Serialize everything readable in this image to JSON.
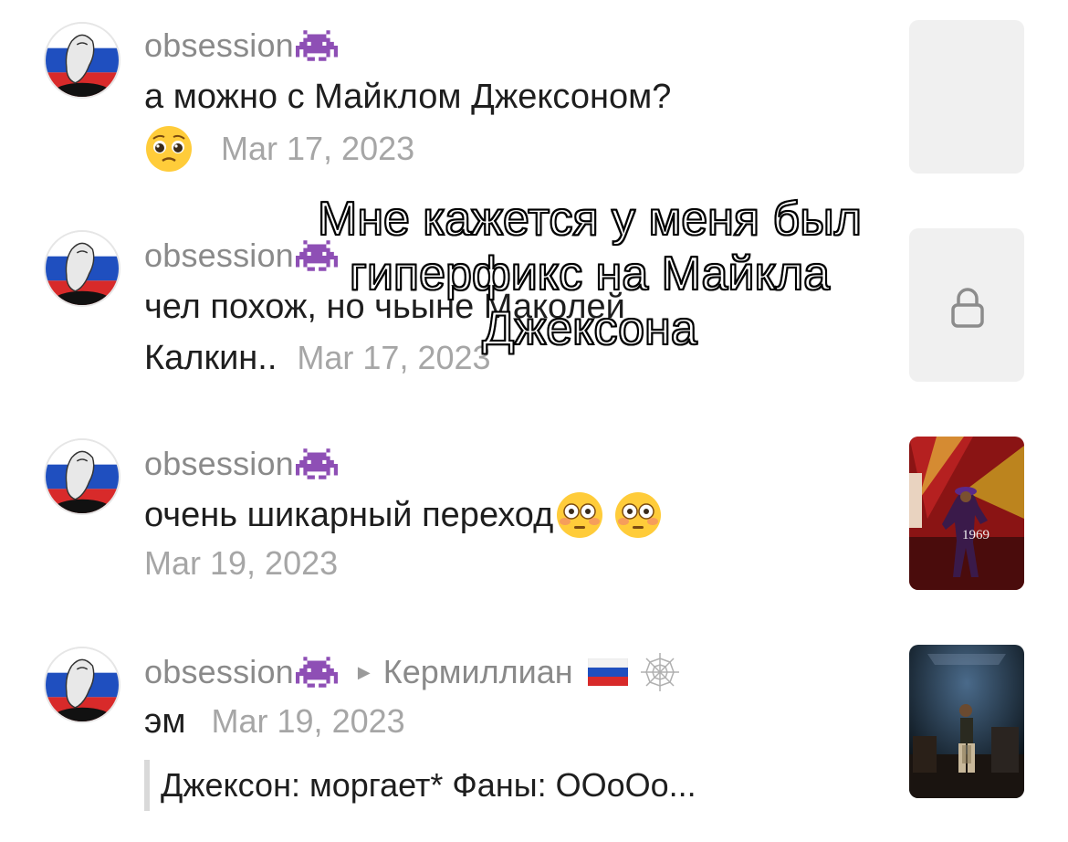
{
  "comments": [
    {
      "username": "obsession",
      "text": "а можно с Майклом Джексоном?",
      "date": "Mar 17, 2023",
      "thumb": "blank"
    },
    {
      "username": "obsession",
      "text_line1": "чел похож, но чьыне Маколей",
      "text_line2": "Калкин..",
      "date": "Mar 17, 2023",
      "thumb": "lock"
    },
    {
      "username": "obsession",
      "text": "очень шикарный переход",
      "date": "Mar 19, 2023",
      "thumb_caption": "1969"
    },
    {
      "username": "obsession",
      "reply_to": "Кермиллиан",
      "text": "эм",
      "date": "Mar 19, 2023",
      "quote": "Джексон: моргает* Фаны: ООоОо..."
    }
  ],
  "overlay": {
    "line1": "Мне кажется у меня был",
    "line2": "гиперфикс на Майкла",
    "line3": "Джексона"
  },
  "icons": {
    "username_badge": "space-invader-icon",
    "lock": "lock-icon",
    "reply": "reply-arrow-icon",
    "flag": "russia-flag-icon",
    "web": "spider-web-icon",
    "pleading": "pleading-face-icon",
    "flushed": "flushed-face-icon"
  },
  "colors": {
    "username": "#8a8a8a",
    "date": "#a6a6a6",
    "text": "#1e1e1e",
    "invader": "#8e4fb5"
  }
}
